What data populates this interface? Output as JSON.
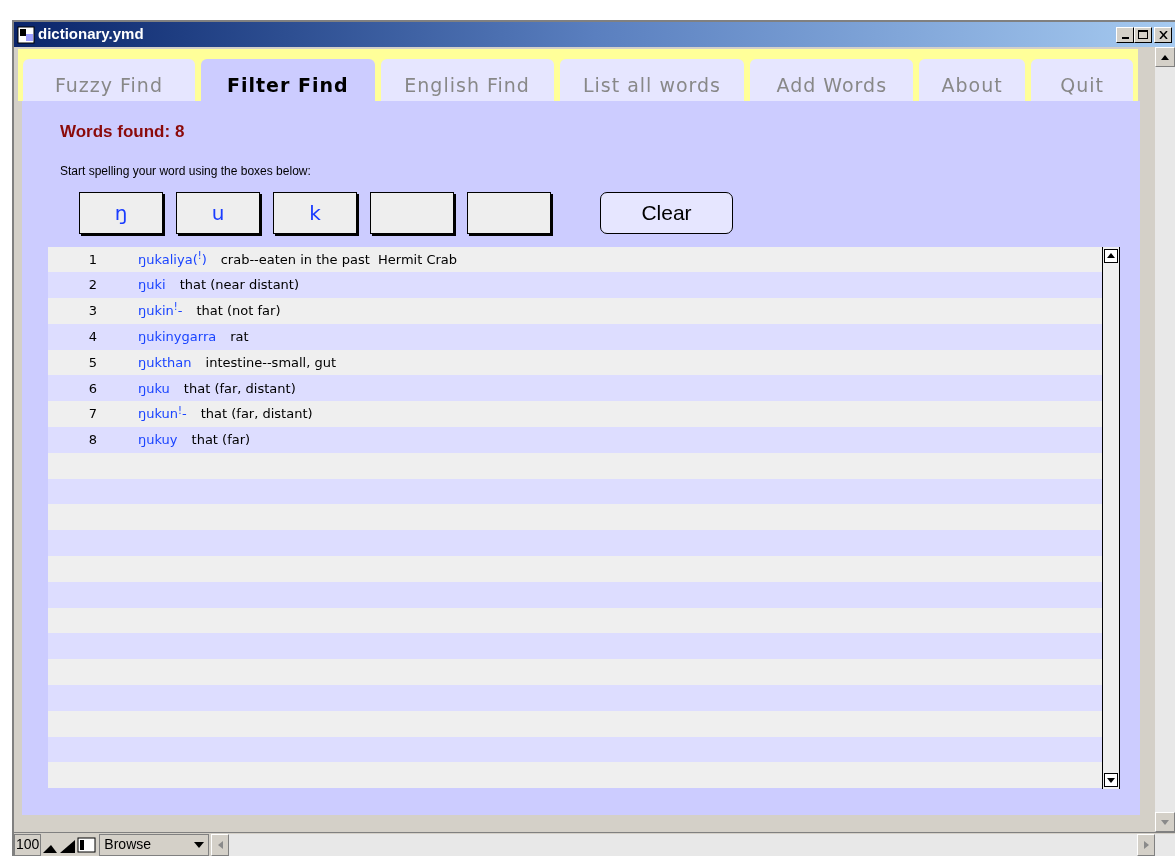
{
  "window": {
    "title": "dictionary.ymd"
  },
  "tabs": [
    {
      "label": "Fuzzy Find",
      "selected": false
    },
    {
      "label": "Filter Find",
      "selected": true
    },
    {
      "label": "English Find",
      "selected": false
    },
    {
      "label": "List all words",
      "selected": false
    },
    {
      "label": "Add Words",
      "selected": false
    },
    {
      "label": "About",
      "selected": false
    },
    {
      "label": "Quit",
      "selected": false
    }
  ],
  "words_found": "Words found: 8",
  "instruction": "Start spelling your word using the boxes below:",
  "letter_boxes": [
    {
      "kind": "filled",
      "value": "ŋ"
    },
    {
      "kind": "filled",
      "value": "u"
    },
    {
      "kind": "filled",
      "value": "k"
    },
    {
      "kind": "empty"
    },
    {
      "kind": "empty"
    }
  ],
  "clear_button": "Clear",
  "results": [
    {
      "number": "1",
      "word": "ŋukaliya($^{!}$)",
      "definition": "crab--eaten in the past  Hermit Crab"
    },
    {
      "number": "2",
      "word": "ŋuki",
      "definition": "that (near distant)"
    },
    {
      "number": "3",
      "word": "ŋukin$^{!}$-",
      "definition": "that (not far)"
    },
    {
      "number": "4",
      "word": "ŋukinygarra",
      "definition": "rat"
    },
    {
      "number": "5",
      "word": "ŋukthan",
      "definition": "intestine--small, gut"
    },
    {
      "number": "6",
      "word": "ŋuku",
      "definition": "that (far, distant)"
    },
    {
      "number": "7",
      "word": "ŋukun$^{!}$-",
      "definition": "that (far, distant)"
    },
    {
      "number": "8",
      "word": "ŋukuy",
      "definition": "that (far)"
    }
  ],
  "status_bar": {
    "zoom": "100",
    "mode": "Browse"
  }
}
